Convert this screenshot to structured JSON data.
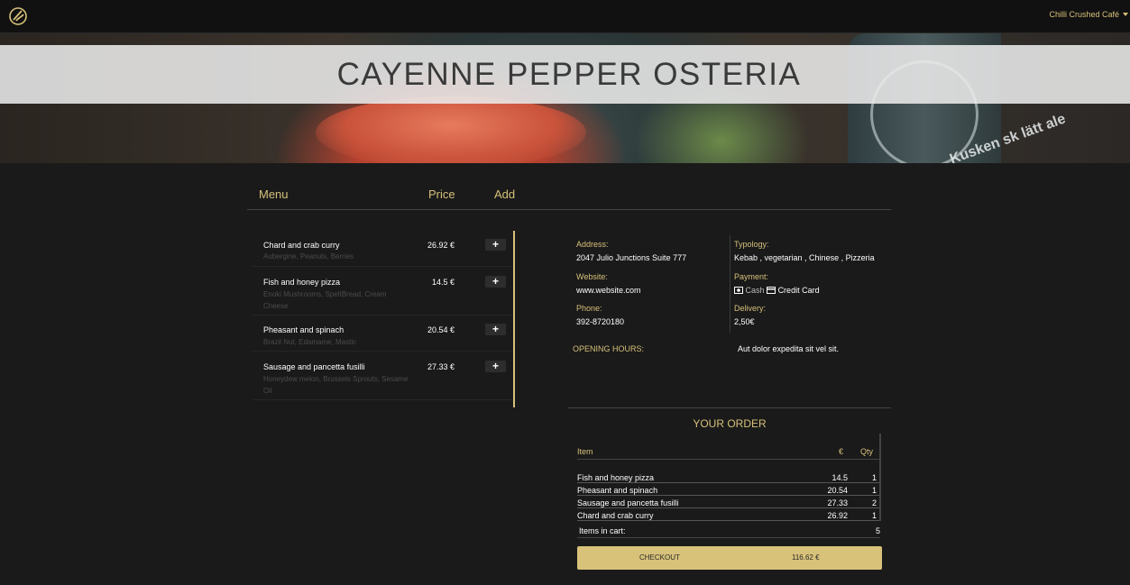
{
  "nav": {
    "user_menu_label": "Chilli Crushed Café"
  },
  "hero": {
    "title": "CAYENNE PEPPER OSTERIA",
    "bottle_text": "Kusken sk lätt ale"
  },
  "menu_header": {
    "menu": "Menu",
    "price": "Price",
    "add": "Add"
  },
  "menu_items": [
    {
      "name": "Chard and crab curry",
      "ingredients": "Aubergine, Peanuts, Berries",
      "price": "26.92 €"
    },
    {
      "name": "Fish and honey pizza",
      "ingredients": "Enoki Mushrooms, SpeltBread, Cream Cheese",
      "price": "14.5 €"
    },
    {
      "name": "Pheasant and spinach",
      "ingredients": "Brazil Nut, Edamame, Mastic",
      "price": "20.54 €"
    },
    {
      "name": "Sausage and pancetta fusilli",
      "ingredients": "Honeydew melon, Brussels Sprouts, Sesame Oil",
      "price": "27.33 €"
    }
  ],
  "info": {
    "address_label": "Address:",
    "address": "2047 Julio Junctions Suite 777",
    "website_label": "Website:",
    "website": "www.website.com",
    "phone_label": "Phone:",
    "phone": "392-8720180",
    "typology_label": "Typology:",
    "typology": "Kebab , vegetarian , Chinese , Pizzeria",
    "payment_label": "Payment:",
    "payment_cash": "Cash",
    "payment_card": "Credit Card",
    "delivery_label": "Delivery:",
    "delivery": "2,50€",
    "opening_label": "OPENING HOURS:",
    "opening": "Aut dolor expedita sit vel sit."
  },
  "order": {
    "title": "YOUR ORDER",
    "headers": {
      "item": "Item",
      "eur": "€",
      "qty": "Qty"
    },
    "rows": [
      {
        "item": "Fish and honey pizza",
        "eur": "14.5",
        "qty": "1"
      },
      {
        "item": "Pheasant and spinach",
        "eur": "20.54",
        "qty": "1"
      },
      {
        "item": "Sausage and pancetta fusilli",
        "eur": "27.33",
        "qty": "2"
      },
      {
        "item": "Chard and crab curry",
        "eur": "26.92",
        "qty": "1"
      }
    ],
    "items_in_cart_label": "Items in cart:",
    "items_in_cart": "5",
    "checkout_label": "CHECKOUT",
    "checkout_total": "116.62 €"
  },
  "colors": {
    "accent": "#d6c07a",
    "background": "#1a1a1a",
    "navbar": "#111111"
  },
  "icons": {
    "logo": "chef-hat-logo-icon",
    "add": "plus-icon",
    "cash": "cash-icon",
    "card": "credit-card-icon",
    "dropdown": "caret-down-icon"
  }
}
